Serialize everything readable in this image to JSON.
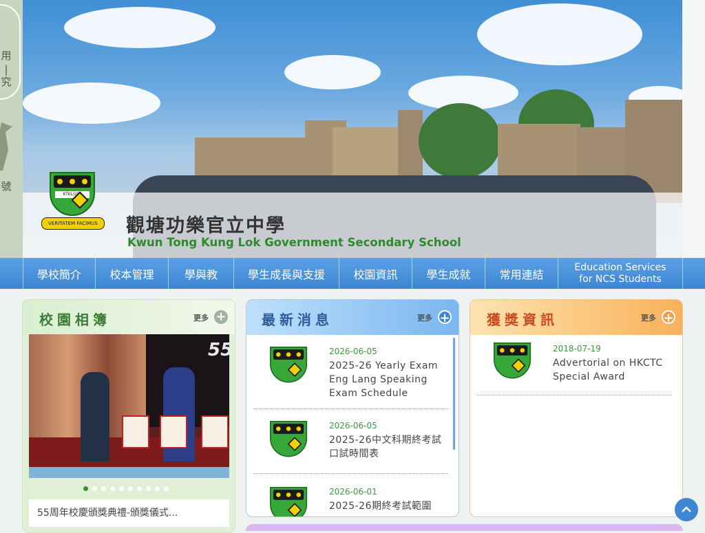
{
  "side_tab": {
    "chars_top": [
      "用",
      "究"
    ],
    "chars_mid": "|",
    "char_bottom": "號"
  },
  "school": {
    "name_cn": "觀塘功樂官立中學",
    "name_en": "Kwun Tong Kung Lok Government Secondary School",
    "logo_abbr": "KTKLGSS",
    "motto": "VERITATEM FACIMUS"
  },
  "nav": {
    "items": [
      "學校簡介",
      "校本管理",
      "學與教",
      "學生成長與支援",
      "校園資訊",
      "學生成就",
      "常用連結"
    ],
    "ncs_line1": "Education Services",
    "ncs_line2": "for NCS Students"
  },
  "album": {
    "title": "校園相簿",
    "more": "更多",
    "photo_number": "55",
    "caption": "55周年校慶頒獎典禮-頒獎儀式...",
    "dots": 10,
    "active_dot": 0
  },
  "news": {
    "title": "最新消息",
    "more": "更多",
    "items": [
      {
        "date": "2026-06-05",
        "title": "2025-26 Yearly Exam Eng Lang Speaking Exam Schedule"
      },
      {
        "date": "2026-06-05",
        "title": "2025-26中文科期終考試口試時間表"
      },
      {
        "date": "2026-06-01",
        "title": "2025-26期終考試範圍"
      }
    ]
  },
  "awards": {
    "title": "獲獎資訊",
    "more": "更多",
    "items": [
      {
        "date": "2018-07-19",
        "title": "Advertorial on HKCTC Special Award"
      }
    ]
  },
  "icons": {
    "plus": "+",
    "to_top": "^"
  },
  "colors": {
    "nav": "#3e86d2",
    "green": "#3d8c3a",
    "orange": "#c94b1f",
    "blue_title": "#2f5d9a"
  }
}
